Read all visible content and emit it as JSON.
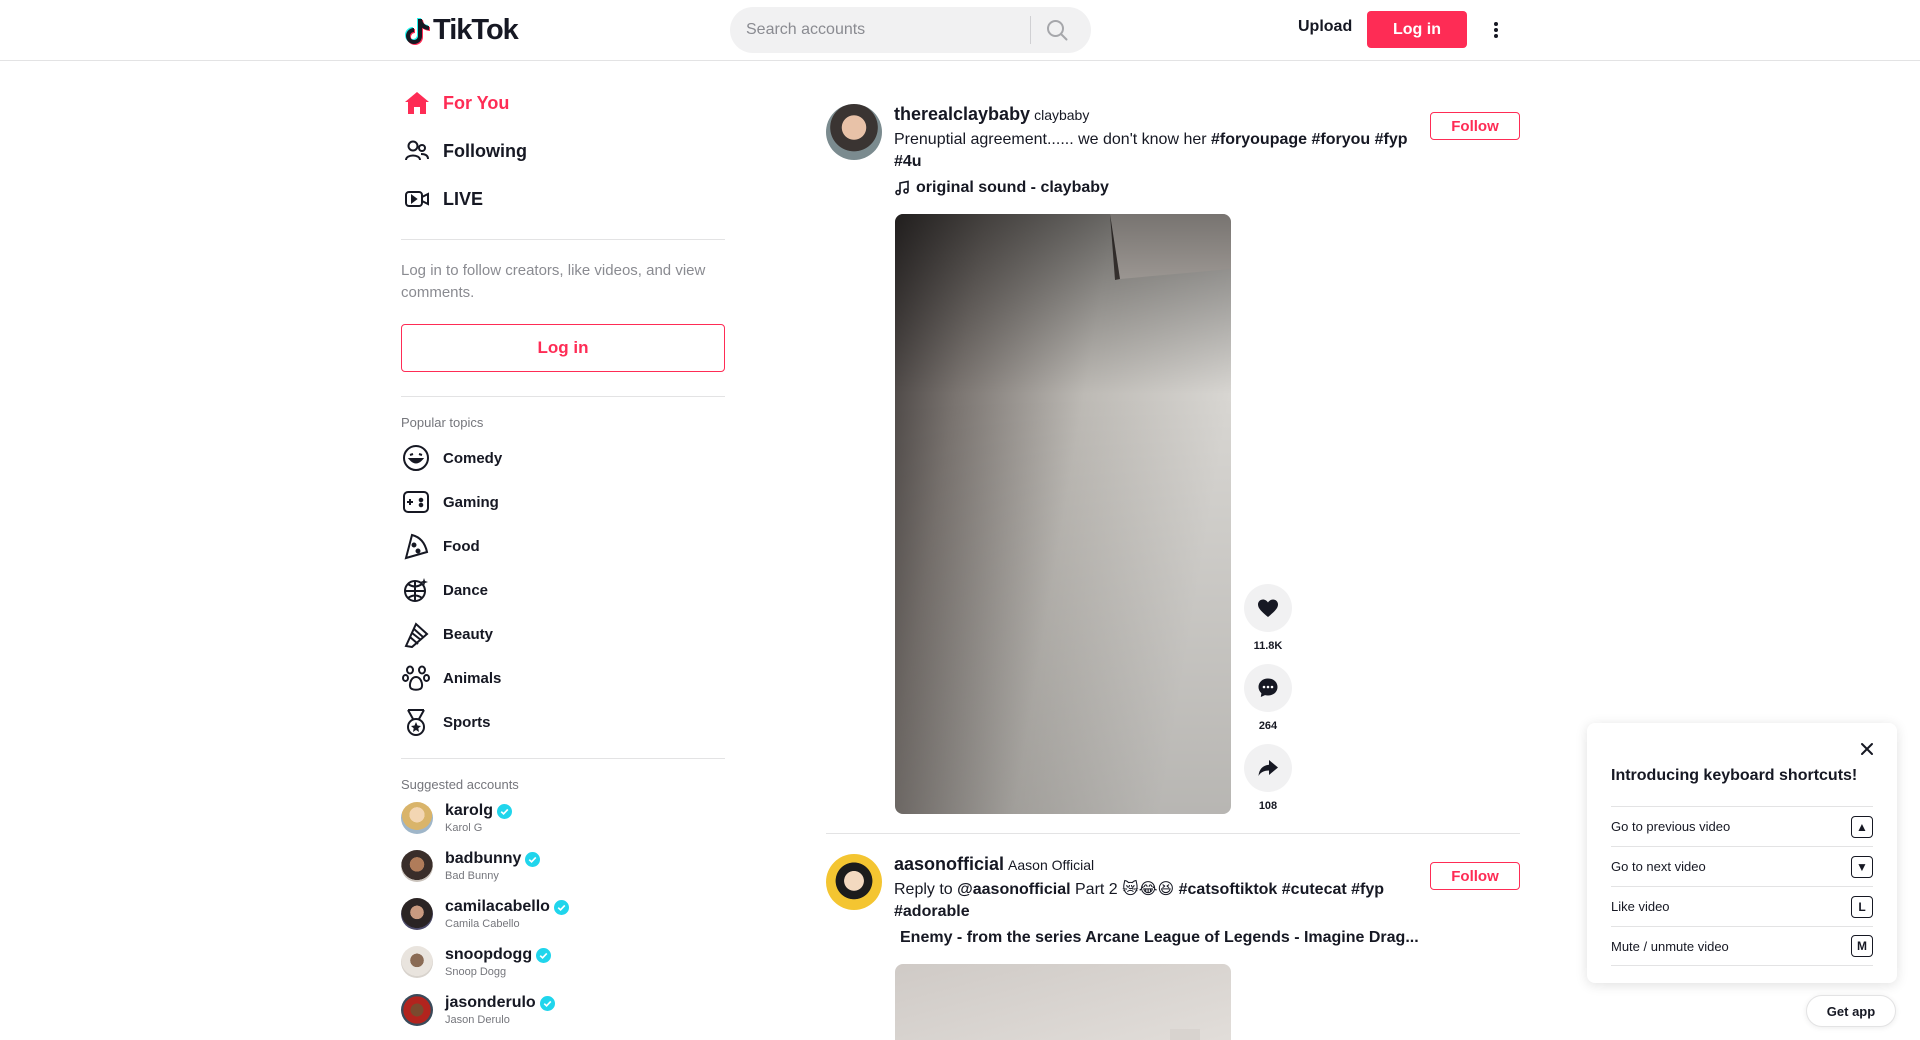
{
  "header": {
    "logo_text": "TikTok",
    "search_placeholder": "Search accounts",
    "upload_label": "Upload",
    "login_label": "Log in"
  },
  "sidebar": {
    "nav": [
      {
        "label": "For You",
        "icon": "home-icon",
        "active": true
      },
      {
        "label": "Following",
        "icon": "users-icon",
        "active": false
      },
      {
        "label": "LIVE",
        "icon": "live-icon",
        "active": false
      }
    ],
    "login_hint": "Log in to follow creators, like videos, and view comments.",
    "login_button": "Log in",
    "popular_topics_title": "Popular topics",
    "topics": [
      {
        "label": "Comedy",
        "icon": "comedy-icon"
      },
      {
        "label": "Gaming",
        "icon": "gaming-icon"
      },
      {
        "label": "Food",
        "icon": "food-icon"
      },
      {
        "label": "Dance",
        "icon": "dance-icon"
      },
      {
        "label": "Beauty",
        "icon": "beauty-icon"
      },
      {
        "label": "Animals",
        "icon": "animals-icon"
      },
      {
        "label": "Sports",
        "icon": "sports-icon"
      }
    ],
    "suggested_title": "Suggested accounts",
    "accounts": [
      {
        "username": "karolg",
        "name": "Karol G"
      },
      {
        "username": "badbunny",
        "name": "Bad Bunny"
      },
      {
        "username": "camilacabello",
        "name": "Camila Cabello"
      },
      {
        "username": "snoopdogg",
        "name": "Snoop Dogg"
      },
      {
        "username": "jasonderulo",
        "name": "Jason Derulo"
      }
    ]
  },
  "feed": {
    "posts": [
      {
        "username": "therealclaybaby",
        "nickname": "claybaby",
        "caption_text": "Prenuptial agreement...... we don't know her ",
        "hashtags": [
          "#foryoupage",
          "#foryou",
          "#fyp",
          "#4u"
        ],
        "music": "original sound - claybaby",
        "follow_label": "Follow",
        "likes": "11.8K",
        "comments": "264",
        "shares": "108"
      },
      {
        "username": "aasonofficial",
        "nickname": "Aason Official",
        "caption_prefix": "Reply to ",
        "mention": "@aasonofficial",
        "caption_text": " Part 2 😿😂😆 ",
        "hashtags": [
          "#catsoftiktok",
          "#cutecat",
          "#fyp",
          "#adorable"
        ],
        "music": "Enemy - from the series Arcane League of Legends - Imagine Drag...",
        "follow_label": "Follow"
      }
    ]
  },
  "shortcuts": {
    "title": "Introducing keyboard shortcuts!",
    "items": [
      {
        "label": "Go to previous video",
        "key": "▲"
      },
      {
        "label": "Go to next video",
        "key": "▼"
      },
      {
        "label": "Like video",
        "key": "L"
      },
      {
        "label": "Mute / unmute video",
        "key": "M"
      }
    ]
  },
  "get_app_label": "Get app",
  "colors": {
    "brand": "#fe2c55",
    "text": "#161823",
    "verified": "#20d5ec"
  }
}
